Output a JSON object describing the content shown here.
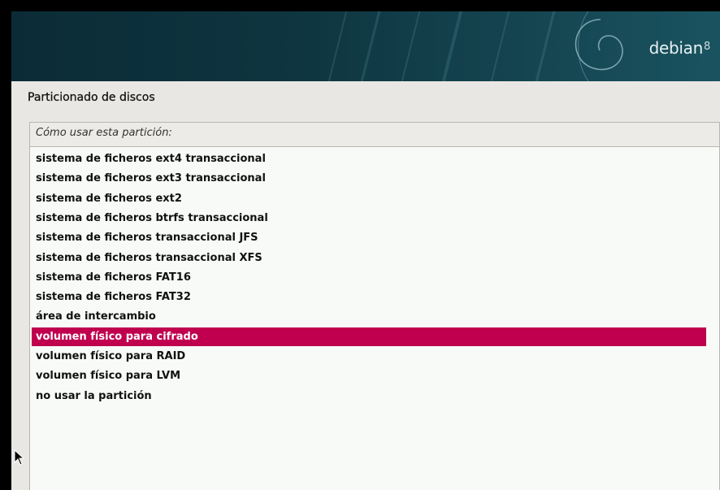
{
  "header": {
    "brand": "debian",
    "version": "8"
  },
  "page": {
    "title": "Particionado de discos",
    "prompt": "Cómo usar esta partición:"
  },
  "options": [
    "sistema de ficheros ext4 transaccional",
    "sistema de ficheros ext3 transaccional",
    "sistema de ficheros ext2",
    "sistema de ficheros btrfs transaccional",
    "sistema de ficheros transaccional JFS",
    "sistema de ficheros transaccional XFS",
    "sistema de ficheros FAT16",
    "sistema de ficheros FAT32",
    "área de intercambio",
    "volumen físico para cifrado",
    "volumen físico para RAID",
    "volumen físico para LVM",
    "no usar la partición"
  ],
  "selected_index": 9,
  "colors": {
    "selection": "#c0004f",
    "banner": "#0e3540",
    "panel": "#e9e7e3"
  },
  "icons": {
    "logo": "debian-swirl-icon",
    "cursor": "mouse-pointer-icon"
  }
}
